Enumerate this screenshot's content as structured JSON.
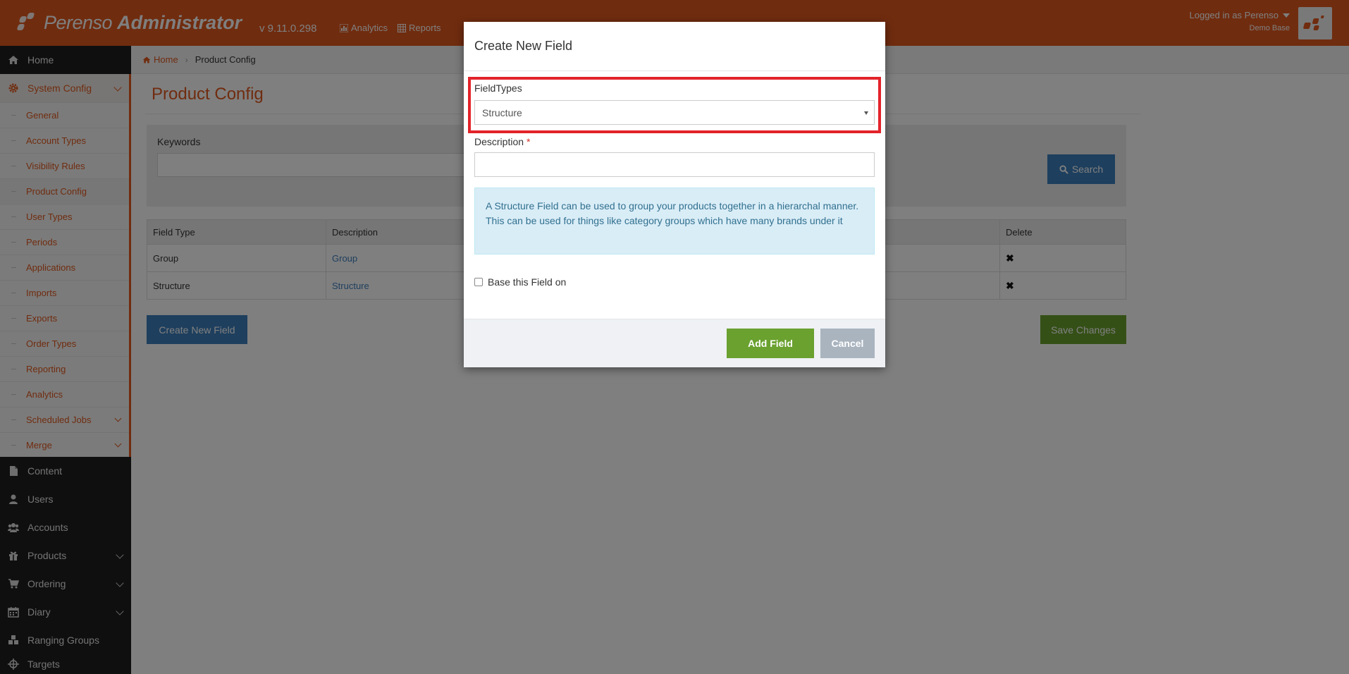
{
  "header": {
    "brand_name": "Perenso",
    "brand_suffix": "Administrator",
    "version": "v 9.11.0.298",
    "nav": [
      {
        "label": "Analytics",
        "icon": "bar-chart-icon"
      },
      {
        "label": "Reports",
        "icon": "table-icon"
      }
    ],
    "user": {
      "logged_in": "Logged in as Perenso",
      "base": "Demo Base"
    }
  },
  "sidebar": {
    "items": [
      {
        "label": "Home",
        "icon": "home-icon"
      },
      {
        "label": "System Config",
        "icon": "gear-icon"
      },
      {
        "label": "Content",
        "icon": "file-icon"
      },
      {
        "label": "Users",
        "icon": "user-icon"
      },
      {
        "label": "Accounts",
        "icon": "users-icon"
      },
      {
        "label": "Products",
        "icon": "gift-icon"
      },
      {
        "label": "Ordering",
        "icon": "cart-icon"
      },
      {
        "label": "Diary",
        "icon": "calendar-icon"
      },
      {
        "label": "Ranging Groups",
        "icon": "cubes-icon"
      },
      {
        "label": "Targets",
        "icon": "crosshairs-icon"
      }
    ],
    "submenu": [
      {
        "label": "General"
      },
      {
        "label": "Account Types"
      },
      {
        "label": "Visibility Rules"
      },
      {
        "label": "Product Config"
      },
      {
        "label": "User Types"
      },
      {
        "label": "Periods"
      },
      {
        "label": "Applications"
      },
      {
        "label": "Imports"
      },
      {
        "label": "Exports"
      },
      {
        "label": "Order Types"
      },
      {
        "label": "Reporting"
      },
      {
        "label": "Analytics"
      },
      {
        "label": "Scheduled Jobs"
      },
      {
        "label": "Merge"
      }
    ]
  },
  "breadcrumb": {
    "home": "Home",
    "current": "Product Config"
  },
  "main": {
    "title": "Product Config",
    "keywords_label": "Keywords",
    "search_label": "Search",
    "table": {
      "headers": [
        "Field Type",
        "Description",
        "Delete"
      ],
      "rows": [
        {
          "field_type": "Group",
          "description": "Group"
        },
        {
          "field_type": "Structure",
          "description": "Structure"
        }
      ]
    },
    "create_button": "Create New Field",
    "save_button": "Save Changes"
  },
  "modal": {
    "title": "Create New Field",
    "fieldtypes_label": "FieldTypes",
    "fieldtypes_value": "Structure",
    "description_label": "Description",
    "required_mark": "*",
    "info_text": "A Structure Field can be used to group your products together in a hierarchal manner. This can be used for things like category groups which have many brands under it",
    "base_checkbox_label": "Base this Field on",
    "add_button": "Add Field",
    "cancel_button": "Cancel"
  },
  "colors": {
    "brand": "#e0591e",
    "primary": "#3d7fbd",
    "success": "#6aa12f",
    "highlight": "#e3232a"
  }
}
